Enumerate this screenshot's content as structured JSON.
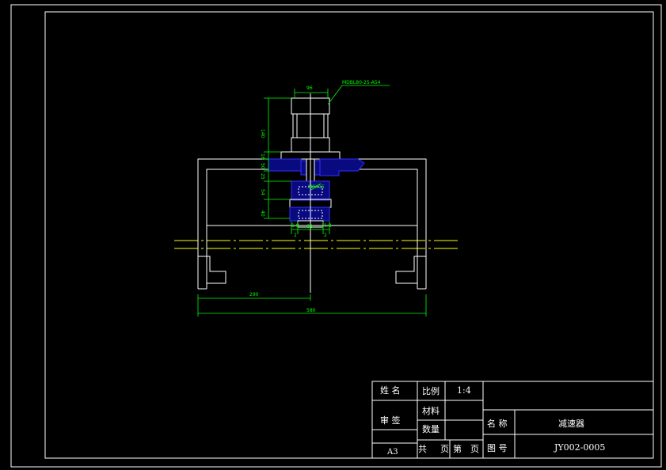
{
  "drawing": {
    "dimensions": {
      "width_96": "96",
      "height_140": "140",
      "gap_16": "16",
      "gap_50": "50",
      "gap_25": "25",
      "gap_54": "54",
      "gap_40": "40",
      "left_2": "2",
      "center_68": "68",
      "right_2": "2",
      "span_290": "290",
      "span_580": "580",
      "side_left": "1.8",
      "side_right": "1.8"
    },
    "callout_motor": "MDBL80-25-A54",
    "callout_part": "M8X15"
  },
  "title_block": {
    "name_label": "姓 名",
    "review_label": "审 签",
    "paper_size": "A3",
    "scale_label": "比例",
    "scale_value": "1:4",
    "material_label": "材料",
    "quantity_label": "数量",
    "total_label": "共",
    "page_label_1": "页",
    "sheet_label": "第",
    "page_label_2": "页",
    "title_label": "名 称",
    "title_value": "减速器",
    "drawing_no_label": "图 号",
    "drawing_no_value": "JY002-0005"
  },
  "colors": {
    "background": "#000000",
    "frame": "#ffffff",
    "dimension": "#00ff00",
    "centerline": "#ffff00",
    "hatch": "#0a0a80"
  }
}
